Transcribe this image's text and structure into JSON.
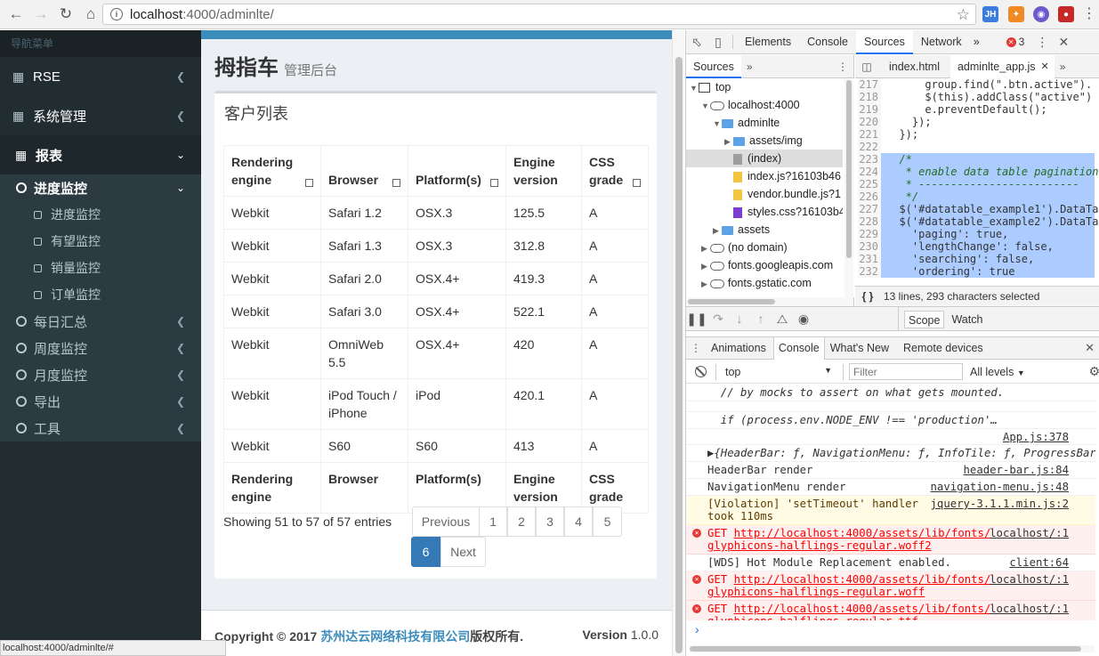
{
  "browser": {
    "url_host": "localhost",
    "url_path": ":4000/adminlte/",
    "ext": [
      "JH",
      "✦",
      "◉",
      "●"
    ]
  },
  "sidebar": {
    "header": "导航菜单",
    "items": [
      {
        "label": "RSE"
      },
      {
        "label": "系统管理"
      },
      {
        "label": "报表"
      }
    ],
    "progress_label": "进度监控",
    "progress_children": [
      "进度监控",
      "有望监控",
      "销量监控",
      "订单监控"
    ],
    "others": [
      "每日汇总",
      "周度监控",
      "月度监控",
      "导出",
      "工具"
    ]
  },
  "content": {
    "title": "拇指车",
    "subtitle": "管理后台",
    "box_title": "客户列表",
    "columns": [
      [
        "Rendering",
        "engine"
      ],
      [
        "Browser"
      ],
      [
        "Platform(s)"
      ],
      [
        "Engine",
        "version"
      ],
      [
        "CSS",
        "grade"
      ]
    ],
    "rows": [
      [
        "Webkit",
        "Safari 1.2",
        "OSX.3",
        "125.5",
        "A"
      ],
      [
        "Webkit",
        "Safari 1.3",
        "OSX.3",
        "312.8",
        "A"
      ],
      [
        "Webkit",
        "Safari 2.0",
        "OSX.4+",
        "419.3",
        "A"
      ],
      [
        "Webkit",
        "Safari 3.0",
        "OSX.4+",
        "522.1",
        "A"
      ],
      [
        "Webkit",
        "OmniWeb 5.5",
        "OSX.4+",
        "420",
        "A"
      ],
      [
        "Webkit",
        "iPod Touch / iPhone",
        "iPod",
        "420.1",
        "A"
      ],
      [
        "Webkit",
        "S60",
        "S60",
        "413",
        "A"
      ]
    ],
    "entries_info": "Showing 51 to 57 of 57 entries",
    "pagination": {
      "previous": "Previous",
      "pages": [
        "1",
        "2",
        "3",
        "4",
        "5"
      ],
      "active": "6",
      "next": "Next"
    }
  },
  "footer": {
    "copy_prefix": "Copyright © 2017 ",
    "company": "苏州达云网络科技有限公司",
    "copy_suffix": "版权所有.",
    "version_label": "Version",
    "version": "1.0.0"
  },
  "status_url": "localhost:4000/adminlte/#",
  "devtools": {
    "tabs": [
      "Elements",
      "Console",
      "Sources",
      "Network"
    ],
    "selected_tab": "Sources",
    "more": "»",
    "error_count": "3",
    "sources_tab": "Sources",
    "file_tabs": [
      "index.html",
      "adminlte_app.js"
    ],
    "tree": [
      {
        "depth": 0,
        "kind": "frame",
        "toggle": "▼",
        "label": "top"
      },
      {
        "depth": 1,
        "kind": "cloud",
        "toggle": "▼",
        "label": "localhost:4000"
      },
      {
        "depth": 2,
        "kind": "folder",
        "toggle": "▼",
        "label": "adminlte"
      },
      {
        "depth": 3,
        "kind": "folder",
        "toggle": "▶",
        "label": "assets/img"
      },
      {
        "depth": 3,
        "kind": "file-grey",
        "toggle": "",
        "label": "(index)",
        "sel": true
      },
      {
        "depth": 3,
        "kind": "file-yellow",
        "toggle": "",
        "label": "index.js?16103b46"
      },
      {
        "depth": 3,
        "kind": "file-yellow",
        "toggle": "",
        "label": "vendor.bundle.js?1"
      },
      {
        "depth": 3,
        "kind": "file-purple",
        "toggle": "",
        "label": "styles.css?16103b4"
      },
      {
        "depth": 2,
        "kind": "folder",
        "toggle": "▶",
        "label": "assets"
      },
      {
        "depth": 1,
        "kind": "cloud",
        "toggle": "▶",
        "label": "(no domain)"
      },
      {
        "depth": 1,
        "kind": "cloud",
        "toggle": "▶",
        "label": "fonts.googleapis.com"
      },
      {
        "depth": 1,
        "kind": "cloud",
        "toggle": "▶",
        "label": "fonts.gstatic.com"
      }
    ],
    "code_lines": [
      {
        "n": "217",
        "t": "      group.find(\".btn.active\").",
        "sel": false
      },
      {
        "n": "218",
        "t": "      $(this).addClass(\"active\")",
        "sel": false
      },
      {
        "n": "219",
        "t": "      e.preventDefault();",
        "sel": false
      },
      {
        "n": "220",
        "t": "    });",
        "sel": false
      },
      {
        "n": "221",
        "t": "  });",
        "sel": false
      },
      {
        "n": "222",
        "t": "",
        "sel": false
      },
      {
        "n": "223",
        "t": "  /*",
        "sel": true,
        "c": true
      },
      {
        "n": "224",
        "t": "   * enable data table pagination",
        "sel": true,
        "c": true
      },
      {
        "n": "225",
        "t": "   * -------------------------",
        "sel": true,
        "c": true
      },
      {
        "n": "226",
        "t": "   */",
        "sel": true,
        "c": true
      },
      {
        "n": "227",
        "t": "  $('#datatable_example1').DataTa",
        "sel": true
      },
      {
        "n": "228",
        "t": "  $('#datatable_example2').DataTa",
        "sel": true
      },
      {
        "n": "229",
        "t": "    'paging': true,",
        "sel": true
      },
      {
        "n": "230",
        "t": "    'lengthChange': false,",
        "sel": true
      },
      {
        "n": "231",
        "t": "    'searching': false,",
        "sel": true
      },
      {
        "n": "232",
        "t": "    'ordering': true",
        "sel": true
      }
    ],
    "selection_info": "13 lines, 293 characters selected",
    "scope": "Scope",
    "watch": "Watch",
    "drawer_tabs": [
      "Animations",
      "Console",
      "What's New",
      "Remote devices"
    ],
    "drawer_selected": "Console",
    "context": "top",
    "filter_placeholder": "Filter",
    "levels": "All levels",
    "console": [
      {
        "kind": "plain",
        "text": "  // by mocks to assert on what gets mounted.",
        "src": "",
        "italic": true
      },
      {
        "kind": "plain",
        "text": "",
        "src": ""
      },
      {
        "kind": "plain",
        "text": "  if (process.env.NODE_ENV !== 'production'…",
        "src": "",
        "italic": true
      },
      {
        "kind": "plain",
        "text": "",
        "src": "App.js:378"
      },
      {
        "kind": "plain",
        "text": "▶{HeaderBar: ƒ, NavigationMenu: ƒ, InfoTile: ƒ, ProgressBar:",
        "src": "",
        "italic": true
      },
      {
        "kind": "plain",
        "text": "HeaderBar render",
        "src": "header-bar.js:84"
      },
      {
        "kind": "plain",
        "text": "NavigationMenu render",
        "src": "navigation-menu.js:48"
      },
      {
        "kind": "warn",
        "text": "[Violation] 'setTimeout' handler\ntook 110ms",
        "src": "jquery-3.1.1.min.js:2"
      },
      {
        "kind": "err",
        "text": "GET ",
        "link": "http://localhost:4000/assets/lib/fonts/",
        "link2": "glyphicons-halflings-regular.woff2",
        "src": "localhost/:1"
      },
      {
        "kind": "plain",
        "text": "[WDS] Hot Module Replacement enabled.",
        "src": "client:64"
      },
      {
        "kind": "err",
        "text": "GET ",
        "link": "http://localhost:4000/assets/lib/fonts/",
        "link2": "glyphicons-halflings-regular.woff",
        "src": "localhost/:1"
      },
      {
        "kind": "err",
        "text": "GET ",
        "link": "http://localhost:4000/assets/lib/fonts/",
        "link2": "glyphicons-halflings-regular.ttf",
        "src": "localhost/:1"
      }
    ],
    "prompt": "›"
  }
}
